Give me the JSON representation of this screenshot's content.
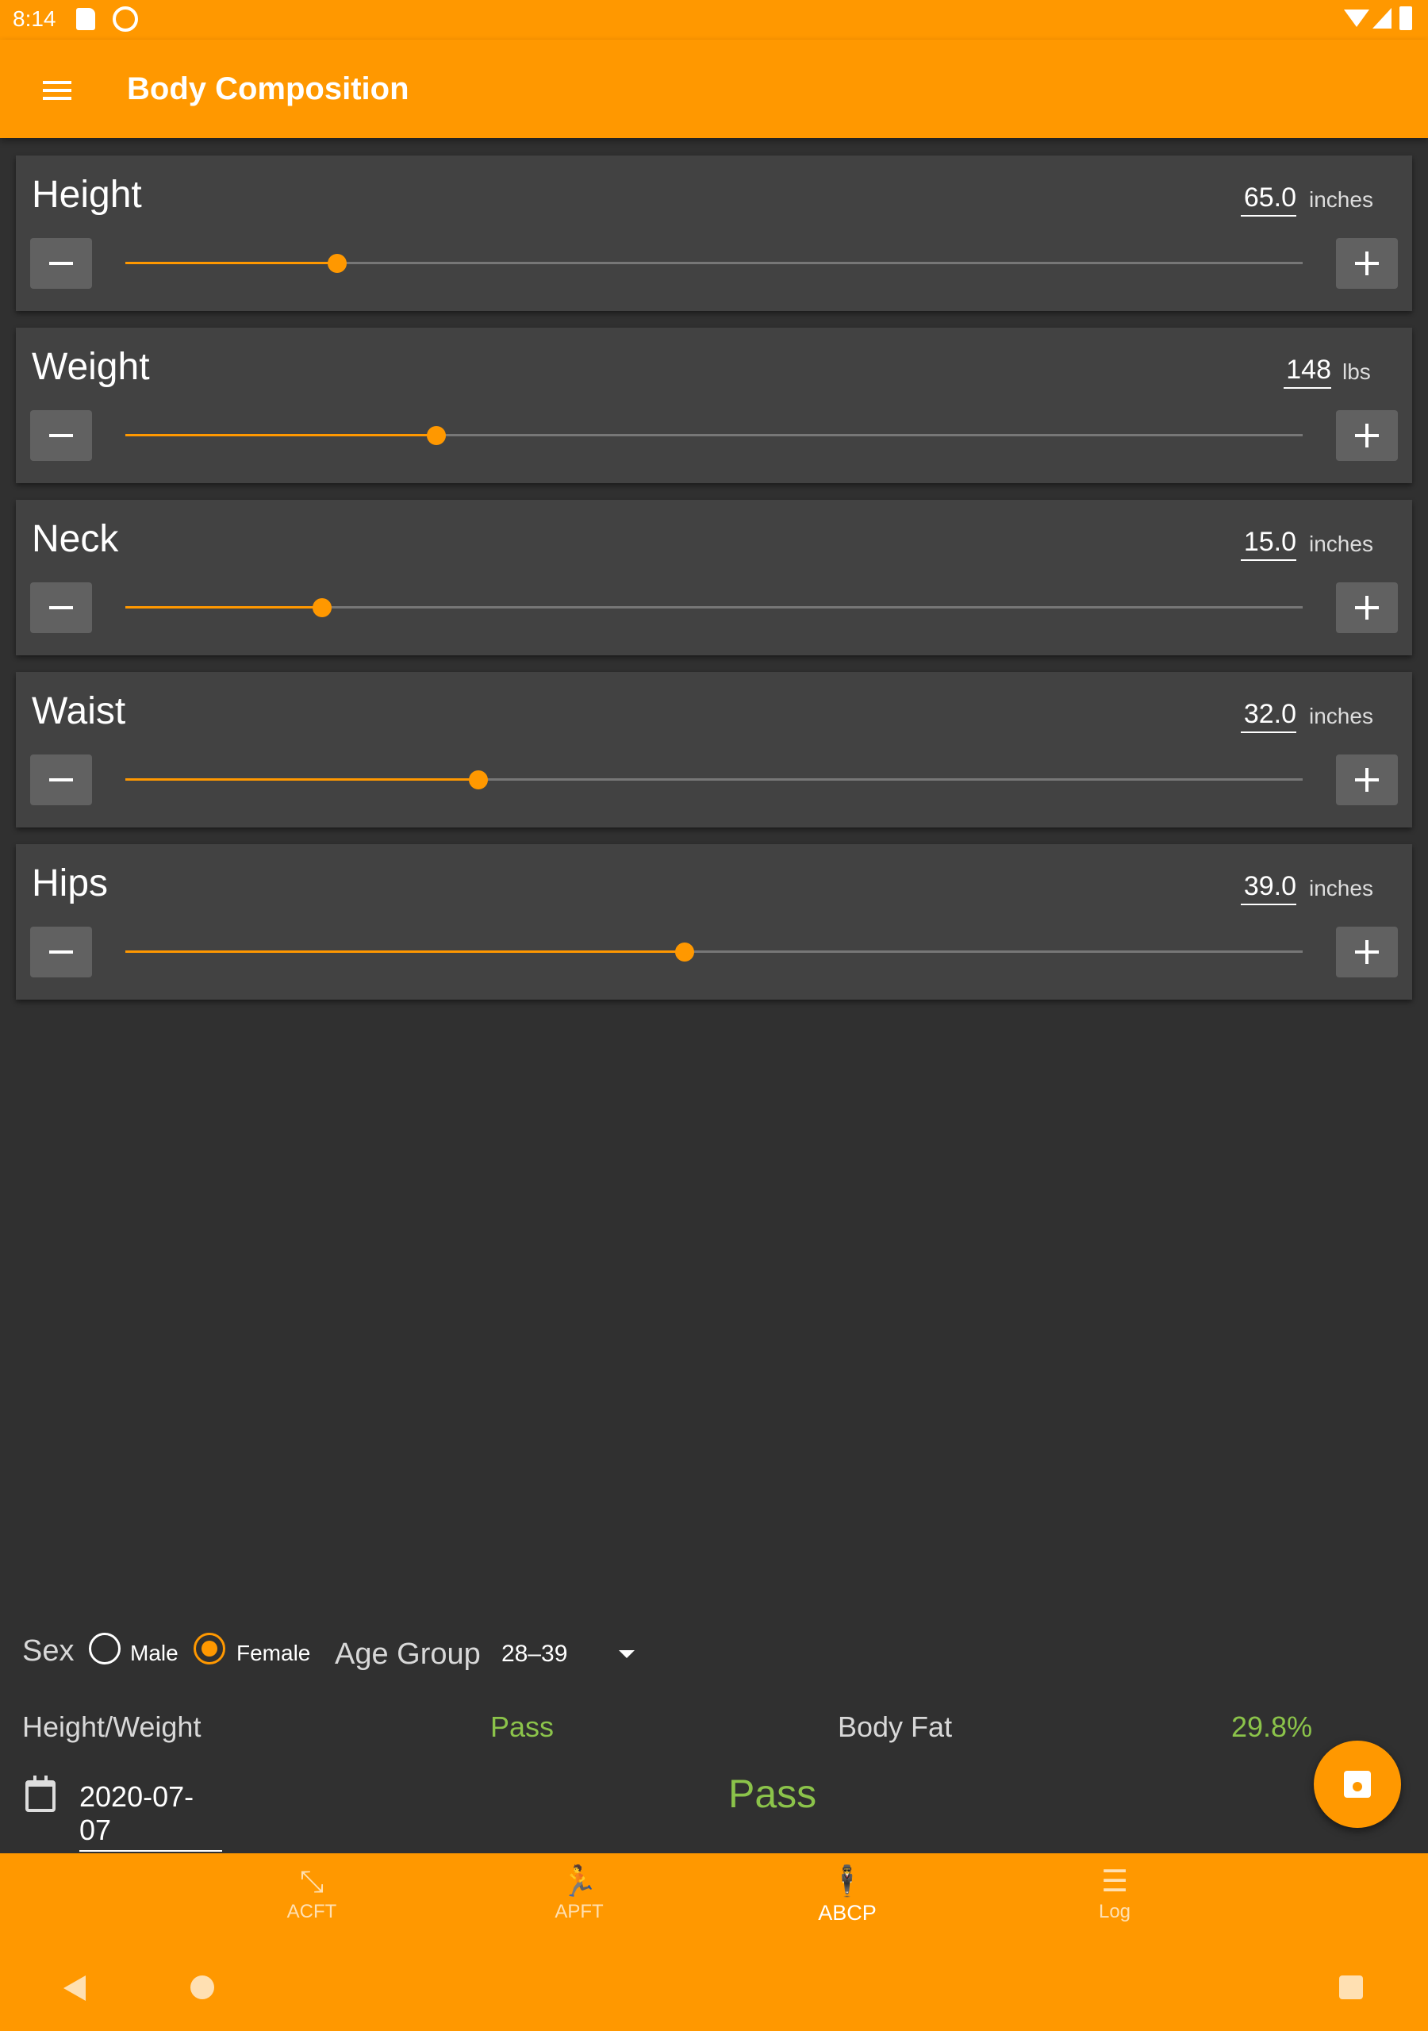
{
  "status_bar": {
    "time": "8:14"
  },
  "app_bar": {
    "title": "Body Composition"
  },
  "measurements": [
    {
      "label": "Height",
      "value": "65.0",
      "unit": "inches",
      "fraction": 0.18
    },
    {
      "label": "Weight",
      "value": "148",
      "unit": "lbs",
      "fraction": 0.264
    },
    {
      "label": "Neck",
      "value": "15.0",
      "unit": "inches",
      "fraction": 0.167
    },
    {
      "label": "Waist",
      "value": "32.0",
      "unit": "inches",
      "fraction": 0.3
    },
    {
      "label": "Hips",
      "value": "39.0",
      "unit": "inches",
      "fraction": 0.475
    }
  ],
  "sex": {
    "label": "Sex",
    "options": [
      "Male",
      "Female"
    ],
    "selected": "Female"
  },
  "age_group": {
    "label": "Age Group",
    "value": "28–39"
  },
  "results": {
    "height_weight_label": "Height/Weight",
    "height_weight_value": "Pass",
    "body_fat_label": "Body Fat",
    "body_fat_value": "29.8%",
    "overall": "Pass",
    "date": "2020-07-07"
  },
  "colors": {
    "accent": "#ff9800",
    "background": "#303030",
    "card": "#424242",
    "pass": "#8bc34a"
  },
  "bottom_nav": [
    {
      "label": "ACFT",
      "icon": "dumbbell-icon",
      "glyph": "⤡"
    },
    {
      "label": "APFT",
      "icon": "runner-icon",
      "glyph": "🏃"
    },
    {
      "label": "ABCP",
      "icon": "person-icon",
      "glyph": "🕴"
    },
    {
      "label": "Log",
      "icon": "log-icon",
      "glyph": "☰"
    }
  ],
  "bottom_nav_active": "ABCP"
}
